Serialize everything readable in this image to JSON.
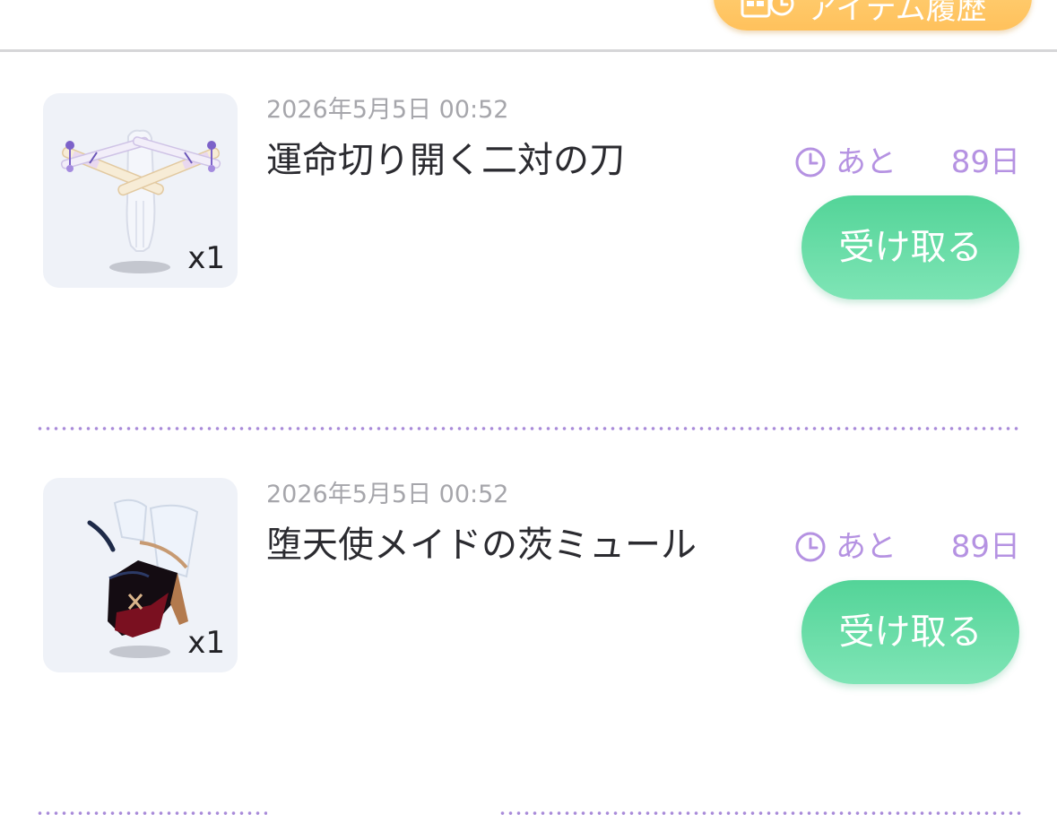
{
  "header": {
    "history_button_label": "アイテム履歴",
    "history_icon": "calendar-clock-icon"
  },
  "items": [
    {
      "date": "2026年5月5日 00:52",
      "name": "運命切り開く二対の刀",
      "quantity": "x1",
      "remaining_prefix": "あと",
      "remaining_days": "89日",
      "claim_label": "受け取る",
      "thumbnail_icon": "twin-swords-icon"
    },
    {
      "date": "2026年5月5日 00:52",
      "name": "堕天使メイドの茨ミュール",
      "quantity": "x1",
      "remaining_prefix": "あと",
      "remaining_days": "89日",
      "claim_label": "受け取る",
      "thumbnail_icon": "mule-shoes-icon"
    }
  ],
  "colors": {
    "accent_purple": "#b592e2",
    "claim_green": "#53d498",
    "history_orange": "#ffc15c",
    "divider_dots": "#a98bd9"
  }
}
